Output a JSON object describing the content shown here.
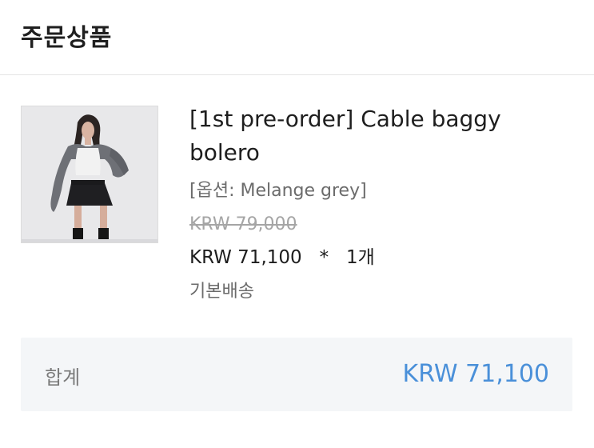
{
  "header": {
    "title": "주문상품"
  },
  "product": {
    "name": "[1st pre-order] Cable baggy bolero",
    "option": "[옵션: Melange grey]",
    "original_price": "KRW 79,000",
    "sale_price": "KRW 71,100",
    "multiply_sign": "*",
    "quantity": "1개",
    "shipping": "기본배송",
    "image_icon": "product-photo"
  },
  "total": {
    "label": "합계",
    "value": "KRW 71,100"
  },
  "colors": {
    "total_value": "#4a90d9",
    "strike_price": "#a5a5a5",
    "total_bg": "#f4f6f8"
  }
}
